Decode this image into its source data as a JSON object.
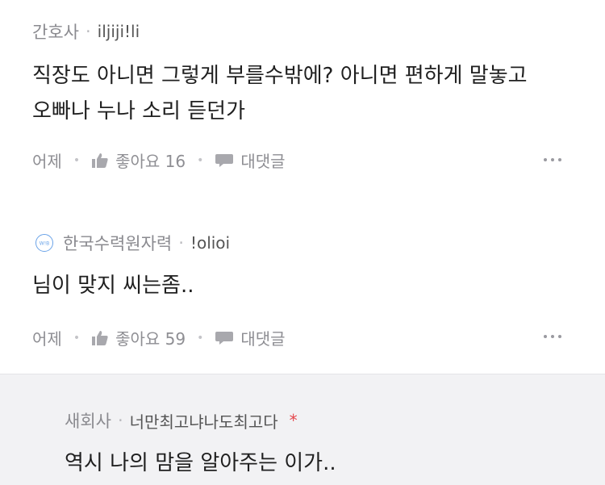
{
  "comments": [
    {
      "company": "간호사",
      "nickname": "iljiji!li",
      "body_lines": [
        "직장도 아니면 그렇게 부를수밖에? 아니면 편하게 말놓고",
        "오빠나 누나 소리 듣던가"
      ],
      "time": "어제",
      "like_label": "좋아요",
      "like_count": "16",
      "reply_label": "대댓글"
    },
    {
      "company": "한국수력원자력",
      "nickname": "!olioi",
      "badge_text": "W!B",
      "body_lines": [
        "님이 맞지 씨는좀.."
      ],
      "time": "어제",
      "like_label": "좋아요",
      "like_count": "59",
      "reply_label": "대댓글"
    },
    {
      "company": "새회사",
      "nickname": "너만최고냐나도최고다",
      "author_mark": "*",
      "body_lines": [
        "역시 나의 맘을 알아주는 이가.."
      ]
    }
  ],
  "separator": "·",
  "colors": {
    "badge": "#6aa3e8",
    "author_mark": "#e5484d",
    "reply_bg": "#f2f2f4"
  },
  "icons": {
    "like": "thumbs-up-icon",
    "reply": "speech-bubble-icon",
    "more": "more-horizontal-icon"
  }
}
